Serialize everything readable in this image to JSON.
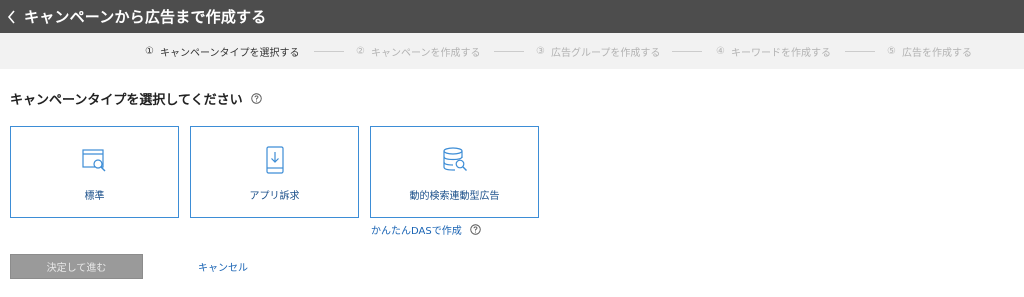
{
  "header": {
    "title": "キャンペーンから広告まで作成する"
  },
  "steps": [
    {
      "num": "①",
      "label": "キャンペーンタイプを選択する"
    },
    {
      "num": "②",
      "label": "キャンペーンを作成する"
    },
    {
      "num": "③",
      "label": "広告グループを作成する"
    },
    {
      "num": "④",
      "label": "キーワードを作成する"
    },
    {
      "num": "⑤",
      "label": "広告を作成する"
    }
  ],
  "main": {
    "section_title": "キャンペーンタイプを選択してください",
    "cards": [
      {
        "label": "標準",
        "icon": "search-window-icon"
      },
      {
        "label": "アプリ訴求",
        "icon": "app-download-icon"
      },
      {
        "label": "動的検索連動型広告",
        "icon": "database-search-icon"
      }
    ],
    "das_link": "かんたんDASで作成"
  },
  "footer": {
    "submit_label": "決定して進む",
    "cancel_label": "キャンセル"
  },
  "colors": {
    "header_bg": "#4d4d4d",
    "card_border": "#3d8dd6",
    "link": "#1a64b4",
    "disabled_button": "#9a9a9a"
  }
}
